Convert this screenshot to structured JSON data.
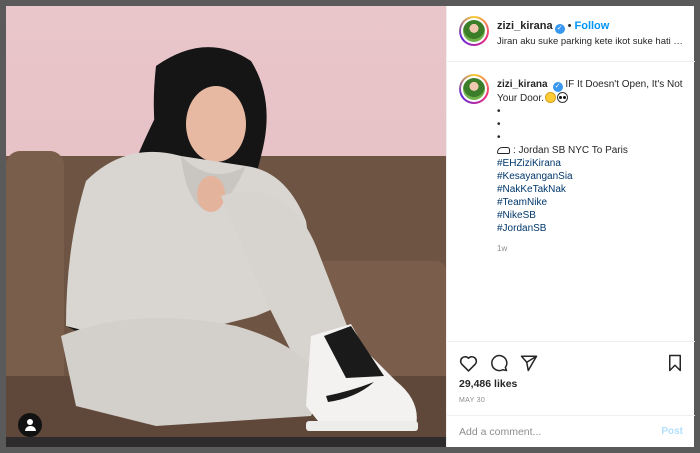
{
  "post": {
    "username": "zizi_kirana",
    "verified_icon": "verified-badge-icon",
    "follow_label": "Follow",
    "location_text": "Jiran aku suke parking kete ikot suke hati dieo..."
  },
  "caption": {
    "username": "zizi_kirana",
    "text": "IF It Doesn't Open, It's Not Your Door.",
    "bullets": [
      "•",
      "•",
      "•"
    ],
    "shoe_line": ": Jordan SB NYC To Paris",
    "hashtags": [
      "#EHZiziKirana",
      "#KesayanganSia",
      "#NakKeTakNak",
      "#TeamNike",
      "#NikeSB",
      "#JordanSB"
    ],
    "time_ago": "1w"
  },
  "actions": {
    "likes": "29,486 likes",
    "date": "MAY 30",
    "comment_placeholder": "Add a comment...",
    "post_label": "Post"
  },
  "colors": {
    "follow": "#0095f6",
    "verified": "#3897f0",
    "hashtag": "#00376b",
    "post_disabled": "#b2dffc",
    "photo_background": "#e6c1c5"
  }
}
